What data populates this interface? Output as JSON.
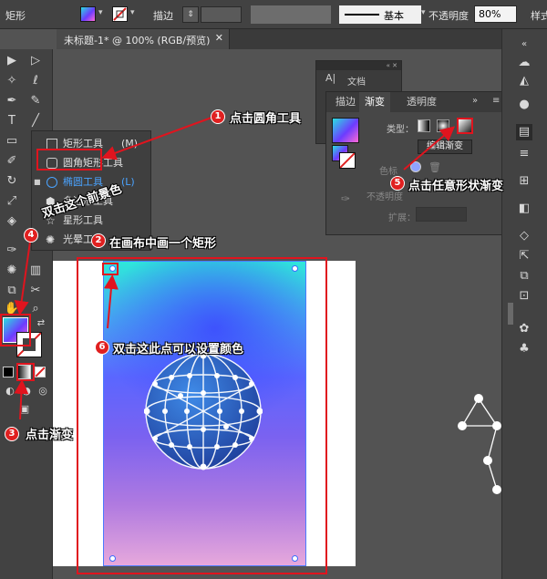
{
  "control_bar": {
    "shape_label": "矩形",
    "stroke_label": "描边",
    "stroke_style": "基本",
    "opacity_label": "不透明度",
    "opacity_value": "80%",
    "style_label": "样式"
  },
  "document": {
    "tab_title": "未标题-1* @ 100% (RGB/预览)"
  },
  "flyout": {
    "items": [
      {
        "label": "矩形工具",
        "shortcut": "(M)"
      },
      {
        "label": "圆角矩形工具",
        "shortcut": ""
      },
      {
        "label": "椭圆工具",
        "shortcut": "(L)"
      },
      {
        "label": "多边形工具",
        "shortcut": ""
      },
      {
        "label": "星形工具",
        "shortcut": ""
      },
      {
        "label": "光晕工具",
        "shortcut": ""
      }
    ]
  },
  "panel_a": {
    "title": "文档"
  },
  "gradient_panel": {
    "tabs": [
      "描边",
      "渐变",
      "透明度"
    ],
    "type_label": "类型：",
    "edit_button": "编辑渐变",
    "color_label": "色标",
    "opacity_label": "不透明度",
    "expand_label": "扩展："
  },
  "annotations": {
    "a1": {
      "num": "1",
      "text": "点击圆角工具"
    },
    "a2": {
      "num": "2",
      "text": "在画布中画一个矩形"
    },
    "a3": {
      "num": "3",
      "text": "点击渐变"
    },
    "a4": {
      "num": "4",
      "text": "双击这个前景色"
    },
    "a5": {
      "num": "5",
      "text": "点击任意形状渐变"
    },
    "a6": {
      "num": "6",
      "text": "双击这此点可以设置颜色"
    }
  },
  "colors": {
    "annotation_red": "#e0141e",
    "gradient_top": "#2ee8da",
    "gradient_mid": "#5a66ff",
    "gradient_bottom": "#e6a8dc"
  }
}
